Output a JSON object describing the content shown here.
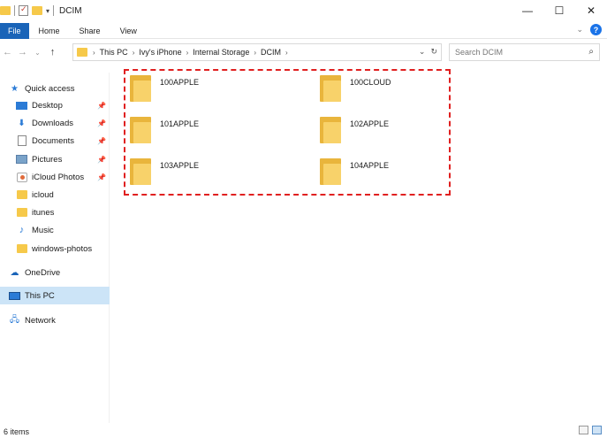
{
  "window": {
    "title": "DCIM",
    "controls": {
      "minimize": "—",
      "maximize": "☐",
      "close": "✕"
    }
  },
  "ribbon": {
    "tabs": [
      "File",
      "Home",
      "Share",
      "View"
    ],
    "help": "?"
  },
  "address_bar": {
    "breadcrumbs": [
      "This PC",
      "Ivy's iPhone",
      "Internal Storage",
      "DCIM"
    ],
    "search_placeholder": "Search DCIM"
  },
  "sidebar": {
    "quick_access": {
      "label": "Quick access",
      "items": [
        {
          "label": "Desktop",
          "icon": "desktop-icon",
          "pinned": true
        },
        {
          "label": "Downloads",
          "icon": "download-icon",
          "pinned": true
        },
        {
          "label": "Documents",
          "icon": "documents-icon",
          "pinned": true
        },
        {
          "label": "Pictures",
          "icon": "pictures-icon",
          "pinned": true
        },
        {
          "label": "iCloud Photos",
          "icon": "icloud-photos-icon",
          "pinned": true
        },
        {
          "label": "icloud",
          "icon": "folder-icon",
          "pinned": false
        },
        {
          "label": "itunes",
          "icon": "folder-icon",
          "pinned": false
        },
        {
          "label": "Music",
          "icon": "music-icon",
          "pinned": false
        },
        {
          "label": "windows-photos",
          "icon": "folder-icon",
          "pinned": false
        }
      ]
    },
    "onedrive": "OneDrive",
    "this_pc": "This PC",
    "network": "Network"
  },
  "content": {
    "folders": [
      "100APPLE",
      "100CLOUD",
      "101APPLE",
      "102APPLE",
      "103APPLE",
      "104APPLE"
    ]
  },
  "status": {
    "item_count": "6 items"
  },
  "colors": {
    "accent": "#1a64b8",
    "selection_box": "#e02020",
    "folder": "#f6c94a"
  }
}
